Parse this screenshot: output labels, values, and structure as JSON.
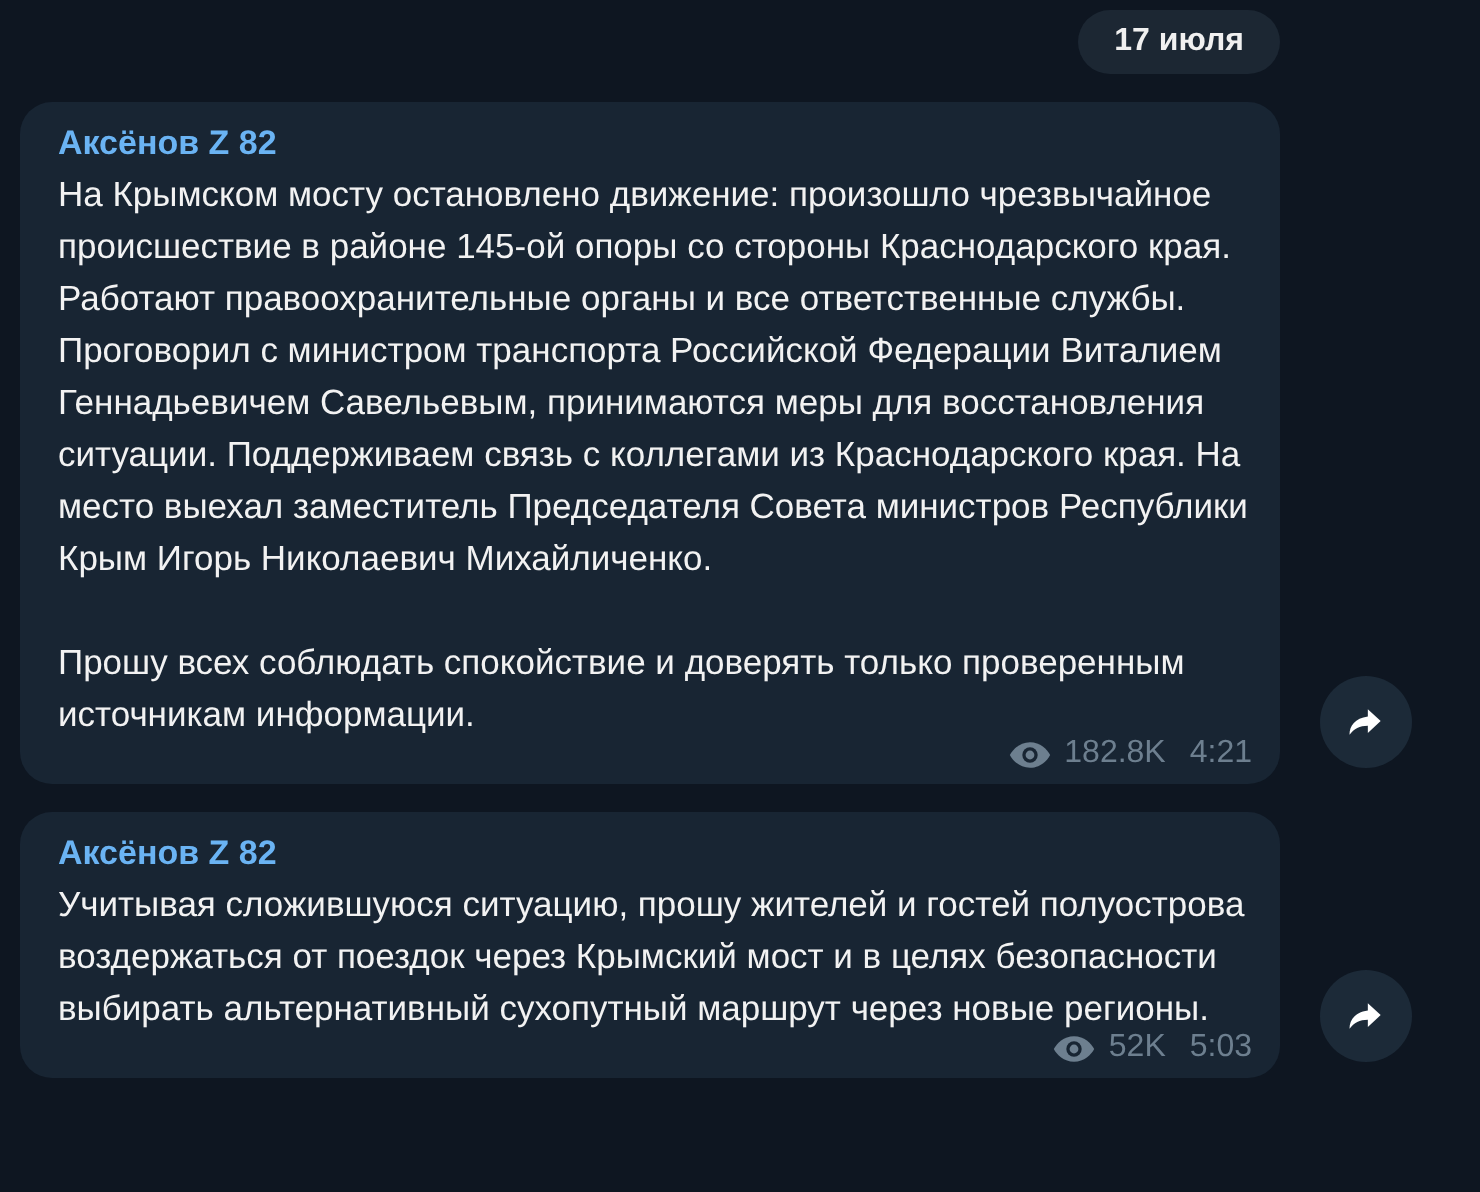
{
  "date_badge": "17 июля",
  "messages": [
    {
      "author": "Аксёнов Z 82",
      "paragraphs": [
        "На Крымском мосту остановлено движение: произошло чрезвычайное происшествие в районе 145-ой опоры со стороны Краснодарского края. Работают правоохранительные органы и все ответственные службы. Проговорил с министром транспорта Российской Федерации Виталием Геннадьевичем Савельевым, принимаются меры для восстановления ситуации. Поддерживаем связь с коллегами из Краснодарского края. На место выехал заместитель Председателя Совета министров Республики Крым Игорь Николаевич Михайличенко.",
        "Прошу всех соблюдать спокойствие и доверять только проверенным источникам информации."
      ],
      "views": "182.8K",
      "time": "4:21"
    },
    {
      "author": "Аксёнов Z 82",
      "paragraphs": [
        "Учитывая сложившуюся ситуацию, прошу жителей и гостей полуострова воздержаться от поездок через Крымский мост и в целях безопасности выбирать альтернативный сухопутный маршрут через новые регионы."
      ],
      "views": "52K",
      "time": "5:03"
    }
  ]
}
